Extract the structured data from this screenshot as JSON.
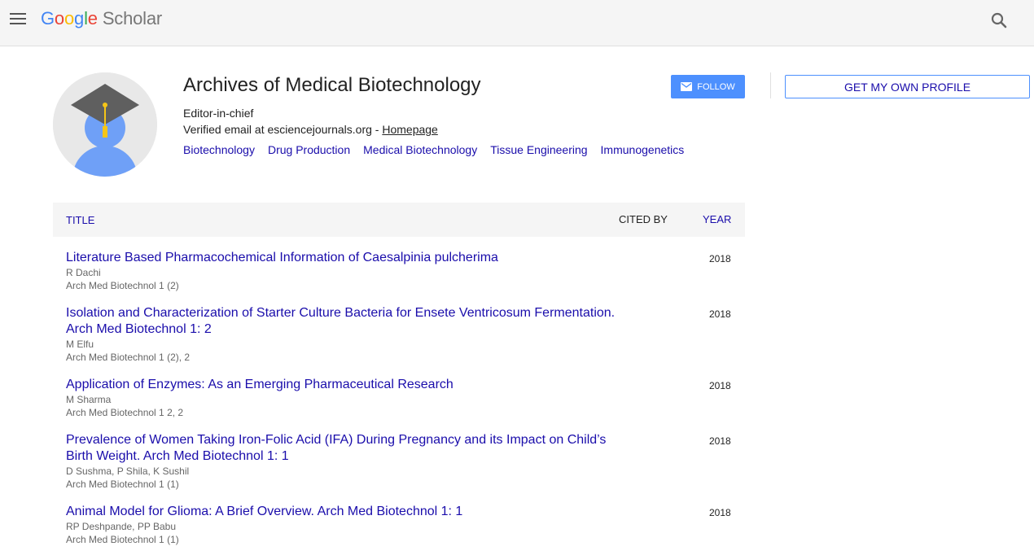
{
  "header": {
    "logo_letters": [
      "G",
      "o",
      "o",
      "g",
      "l",
      "e"
    ],
    "logo_product": "Scholar"
  },
  "profile": {
    "name": "Archives of Medical Biotechnology",
    "affiliation": "Editor-in-chief",
    "email_text": "Verified email at esciencejournals.org - ",
    "homepage_label": "Homepage",
    "interests": [
      "Biotechnology",
      "Drug Production",
      "Medical Biotechnology",
      "Tissue Engineering",
      "Immunogenetics"
    ],
    "follow_label": "FOLLOW"
  },
  "sidebar": {
    "get_profile_label": "GET MY OWN PROFILE"
  },
  "table": {
    "col_title": "TITLE",
    "col_cited": "CITED BY",
    "col_year": "YEAR",
    "rows": [
      {
        "title": "Literature Based Pharmacochemical Information of Caesalpinia pulcherima",
        "authors": "R Dachi",
        "venue": "Arch Med Biotechnol 1 (2)",
        "year": "2018"
      },
      {
        "title": "Isolation and Characterization of Starter Culture Bacteria for Ensete Ventricosum Fermentation. Arch Med Biotechnol 1: 2",
        "authors": "M Elfu",
        "venue": "Arch Med Biotechnol 1 (2), 2",
        "year": "2018"
      },
      {
        "title": "Application of Enzymes: As an Emerging Pharmaceutical Research",
        "authors": "M Sharma",
        "venue": "Arch Med Biotechnol 1 2, 2",
        "year": "2018"
      },
      {
        "title": "Prevalence of Women Taking Iron-Folic Acid (IFA) During Pregnancy and its Impact on Child’s Birth Weight. Arch Med Biotechnol 1: 1",
        "authors": "D Sushma, P Shila, K Sushil",
        "venue": "Arch Med Biotechnol 1 (1)",
        "year": "2018"
      },
      {
        "title": "Animal Model for Glioma: A Brief Overview. Arch Med Biotechnol 1: 1",
        "authors": "RP Deshpande, PP Babu",
        "venue": "Arch Med Biotechnol 1 (1)",
        "year": "2018"
      }
    ]
  },
  "colors": {
    "link": "#1a0dab",
    "follow_button": "#4d90fe",
    "header_bg": "#f5f5f5"
  },
  "icons": {
    "menu": "menu-icon",
    "search": "search-icon",
    "mail": "mail-icon",
    "avatar": "graduate-avatar-icon"
  }
}
